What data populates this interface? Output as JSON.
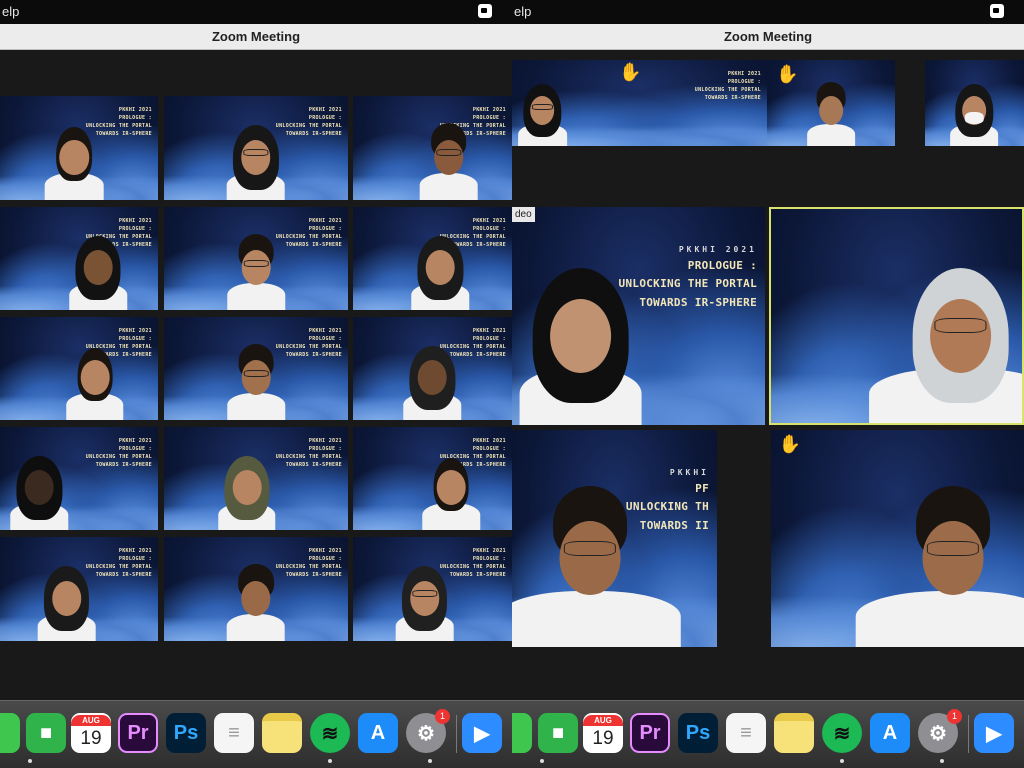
{
  "menubar": {
    "left_menu": "elp",
    "right_menu": "elp"
  },
  "window": {
    "title": "Zoom Meeting"
  },
  "backdrop": {
    "lines": [
      "PKKHI 2021",
      "PROLOGUE :",
      "UNLOCKING THE PORTAL",
      "TOWARDS IR-SPHERE"
    ],
    "partial_lines": [
      "PKKHI",
      "PF",
      "UNLOCKING TH",
      "TOWARDS II"
    ]
  },
  "right_screen": {
    "tile_label": "deo"
  },
  "dock": {
    "calendar_month": "AUG",
    "calendar_day": "19",
    "premiere_label": "Pr",
    "photoshop_label": "Ps",
    "settings_badge": "1",
    "colors": {
      "facetime": "#2fb34a",
      "premiere": "#2a0a3a",
      "premiere_text": "#e58cff",
      "photoshop": "#001e36",
      "photoshop_text": "#31a8ff",
      "spotify": "#1db954",
      "appstore": "#1d8cf8",
      "zoom": "#2d8cff"
    }
  }
}
